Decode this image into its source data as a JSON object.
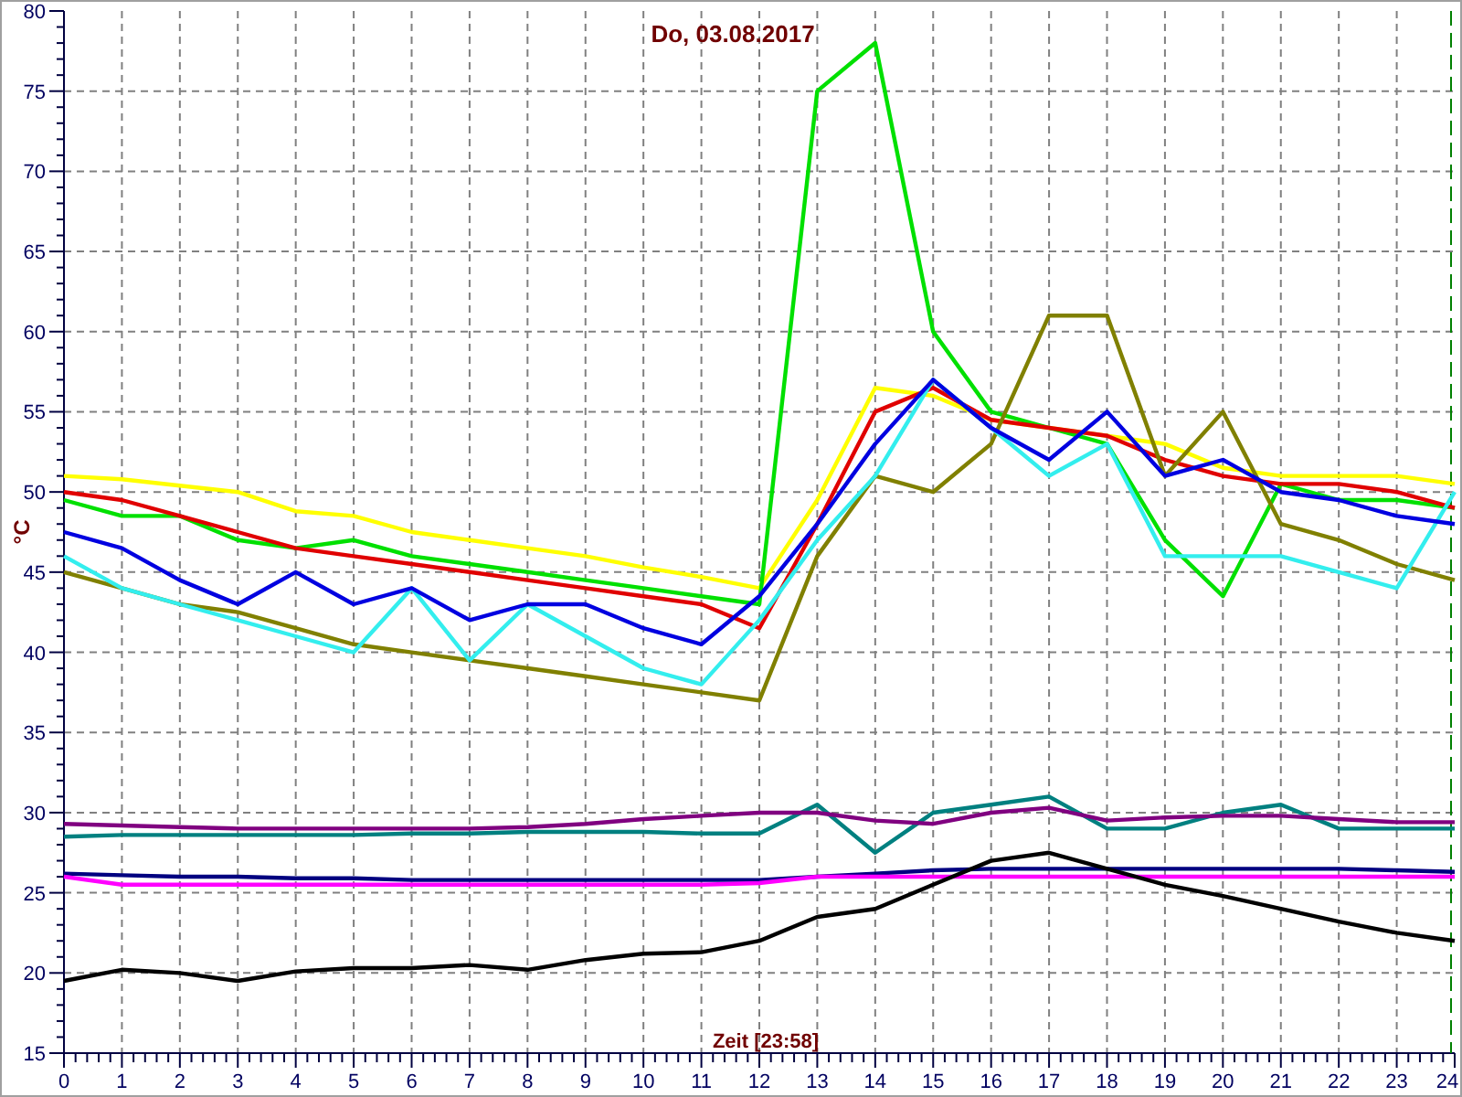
{
  "chart": {
    "chart_data": {
      "type": "line",
      "title": "Do, 03.08.2017",
      "xlabel": "Zeit [23:58]",
      "ylabel": "°C",
      "x": [
        0,
        1,
        2,
        3,
        4,
        5,
        6,
        7,
        8,
        9,
        10,
        11,
        12,
        13,
        14,
        15,
        16,
        17,
        18,
        19,
        20,
        21,
        22,
        23,
        24
      ],
      "series": [
        {
          "color": "#ffff00",
          "values": [
            51,
            50.8,
            50.4,
            50,
            48.8,
            48.5,
            47.5,
            47,
            46.5,
            46,
            45.3,
            44.7,
            44,
            49.5,
            56.5,
            56,
            54.5,
            54,
            53.5,
            53,
            51.5,
            51,
            51,
            51,
            50.5
          ]
        },
        {
          "color": "#00e000",
          "values": [
            49.5,
            48.5,
            48.5,
            47,
            46.5,
            47,
            46,
            45.5,
            45,
            44.5,
            44,
            43.5,
            43,
            75,
            78,
            60,
            55,
            54,
            53,
            47,
            43.5,
            50.5,
            49.5,
            49.5,
            49
          ]
        },
        {
          "color": "#e00000",
          "values": [
            50,
            49.5,
            48.5,
            47.5,
            46.5,
            46,
            45.5,
            45,
            44.5,
            44,
            43.5,
            43,
            41.5,
            48,
            55,
            56.5,
            54.5,
            54,
            53.5,
            52,
            51,
            50.5,
            50.5,
            50,
            49
          ]
        },
        {
          "color": "#808000",
          "values": [
            45,
            44,
            43,
            42.5,
            41.5,
            40.5,
            40,
            39.5,
            39,
            38.5,
            38,
            37.5,
            37,
            46,
            51,
            50,
            53,
            61,
            61,
            51,
            55,
            48,
            47,
            45.5,
            44.5
          ]
        },
        {
          "color": "#33eeee",
          "values": [
            46,
            44,
            43,
            42,
            41,
            40,
            44,
            39.5,
            43,
            41,
            39,
            38,
            42,
            47,
            51,
            57,
            54,
            51,
            53,
            46,
            46,
            46,
            45,
            44,
            50
          ]
        },
        {
          "color": "#0000e0",
          "values": [
            47.5,
            46.5,
            44.5,
            43,
            45,
            43,
            44,
            42,
            43,
            43,
            41.5,
            40.5,
            43.5,
            48,
            53,
            57,
            54,
            52,
            55,
            51,
            52,
            50,
            49.5,
            48.5,
            48
          ]
        },
        {
          "color": "#008080",
          "values": [
            28.5,
            28.6,
            28.6,
            28.6,
            28.6,
            28.6,
            28.7,
            28.7,
            28.8,
            28.8,
            28.8,
            28.7,
            28.7,
            30.5,
            27.5,
            30,
            30.5,
            31,
            29,
            29,
            30,
            30.5,
            29,
            29,
            29
          ]
        },
        {
          "color": "#800080",
          "values": [
            29.3,
            29.2,
            29.1,
            29,
            29,
            29,
            29,
            29,
            29.1,
            29.3,
            29.6,
            29.8,
            30,
            30,
            29.5,
            29.3,
            30,
            30.3,
            29.5,
            29.7,
            29.8,
            29.8,
            29.6,
            29.4,
            29.4
          ]
        },
        {
          "color": "#000080",
          "values": [
            26.2,
            26.1,
            26,
            26,
            25.9,
            25.9,
            25.8,
            25.8,
            25.8,
            25.8,
            25.8,
            25.8,
            25.8,
            26,
            26.2,
            26.4,
            26.5,
            26.5,
            26.5,
            26.5,
            26.5,
            26.5,
            26.5,
            26.4,
            26.3
          ]
        },
        {
          "color": "#ff00ff",
          "values": [
            26,
            25.5,
            25.5,
            25.5,
            25.5,
            25.5,
            25.5,
            25.5,
            25.5,
            25.5,
            25.5,
            25.5,
            25.6,
            26,
            26,
            26,
            26,
            26,
            26,
            26,
            26,
            26,
            26,
            26,
            26
          ]
        },
        {
          "color": "#000000",
          "values": [
            19.5,
            20.2,
            20,
            19.5,
            20.1,
            20.3,
            20.3,
            20.5,
            20.2,
            20.8,
            21.2,
            21.3,
            22,
            23.5,
            24,
            25.5,
            27,
            27.5,
            26.5,
            25.5,
            24.8,
            24,
            23.2,
            22.5,
            22
          ]
        }
      ],
      "xlim": [
        0,
        24
      ],
      "ylim": [
        15,
        80
      ],
      "xticks": [
        0,
        1,
        2,
        3,
        4,
        5,
        6,
        7,
        8,
        9,
        10,
        11,
        12,
        13,
        14,
        15,
        16,
        17,
        18,
        19,
        20,
        21,
        22,
        23,
        24
      ],
      "yticks": [
        15,
        20,
        25,
        30,
        35,
        40,
        45,
        50,
        55,
        60,
        65,
        70,
        75,
        80
      ],
      "grid": true
    }
  }
}
